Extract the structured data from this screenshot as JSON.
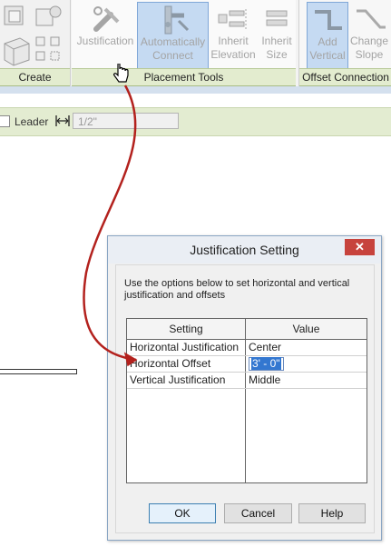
{
  "ribbon": {
    "create": {
      "title": "Create",
      "icons": [
        "family-icon",
        "component-icon",
        "walls-icon",
        "pattern-icon"
      ]
    },
    "placement_tools": {
      "title": "Placement Tools",
      "tools": [
        {
          "name": "justification",
          "label1": "Justification",
          "label2": "",
          "icon": "justification-icon",
          "active": false
        },
        {
          "name": "automatically-connect",
          "label1": "Automatically",
          "label2": "Connect",
          "icon": "connect-icon",
          "active": true
        },
        {
          "name": "inherit-elevation",
          "label1": "Inherit",
          "label2": "Elevation",
          "icon": "inherit-elevation-icon",
          "active": false
        },
        {
          "name": "inherit-size",
          "label1": "Inherit",
          "label2": "Size",
          "icon": "inherit-size-icon",
          "active": false
        }
      ]
    },
    "offset_connections": {
      "title": "Offset Connection",
      "tools": [
        {
          "name": "add-vertical",
          "label1": "Add",
          "label2": "Vertical",
          "icon": "add-vertical-icon",
          "active": true
        },
        {
          "name": "change-slope",
          "label1": "Change",
          "label2": "Slope",
          "icon": "change-slope-icon",
          "active": false
        }
      ]
    }
  },
  "options_bar": {
    "leader_label": "Leader",
    "leader_checked": false,
    "leader_length": "1/2\""
  },
  "dialog": {
    "title": "Justification Setting",
    "close_label": "✕",
    "instructions": "Use the options below to set horizontal and vertical justification and offsets",
    "grid": {
      "headers": [
        "Setting",
        "Value"
      ],
      "rows": [
        {
          "setting": "Horizontal Justification",
          "value": "Center"
        },
        {
          "setting": "Horizontal Offset",
          "value": "3' - 0\""
        },
        {
          "setting": "Vertical Justification",
          "value": "Middle"
        }
      ]
    },
    "buttons": {
      "ok": "OK",
      "cancel": "Cancel",
      "help": "Help"
    }
  },
  "colors": {
    "panel_title_bg": "#e3eccf",
    "active_tool_bg": "#c5daf2",
    "close_button": "#c7433d",
    "annotation_arrow": "#b3211d",
    "selection": "#3377d0"
  }
}
